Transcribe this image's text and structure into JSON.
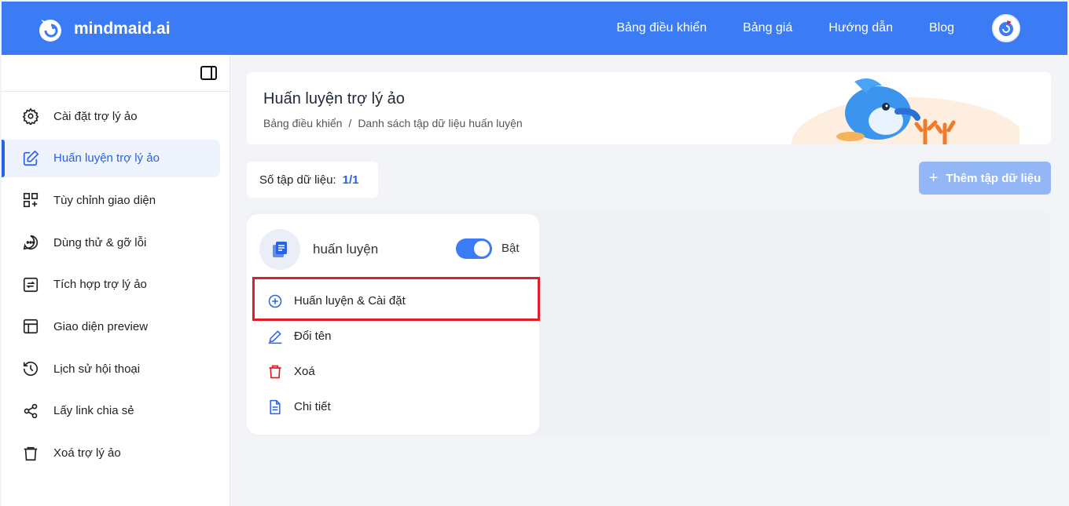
{
  "brand": {
    "name": "mindmaid.ai"
  },
  "nav": [
    "Bảng điều khiển",
    "Bảng giá",
    "Hướng dẫn",
    "Blog"
  ],
  "sidebar": {
    "items": [
      {
        "label": "Cài đặt trợ lý ảo",
        "icon": "gear-icon"
      },
      {
        "label": "Huấn luyện trợ lý ảo",
        "icon": "edit-icon",
        "active": true
      },
      {
        "label": "Tùy chỉnh giao diện",
        "icon": "grid-plus-icon"
      },
      {
        "label": "Dùng thử & gỡ lỗi",
        "icon": "chat-icon"
      },
      {
        "label": "Tích hợp trợ lý ảo",
        "icon": "integration-icon"
      },
      {
        "label": "Giao diện preview",
        "icon": "layout-icon"
      },
      {
        "label": "Lịch sử hội thoại",
        "icon": "history-icon"
      },
      {
        "label": "Lấy link chia sẻ",
        "icon": "share-icon"
      },
      {
        "label": "Xoá trợ lý ảo",
        "icon": "trash-icon"
      }
    ]
  },
  "header": {
    "title": "Huấn luyện trợ lý ảo",
    "breadcrumb": [
      "Bảng điều khiển",
      "/",
      "Danh sách tập dữ liệu huấn luyện"
    ]
  },
  "count": {
    "label": "Số tập dữ liệu:",
    "value": "1/1"
  },
  "add_button": {
    "label": "Thêm tập dữ liệu"
  },
  "dataset": {
    "name": "huấn luyện",
    "toggle_label": "Bật",
    "actions": [
      {
        "label": "Huấn luyện & Cài đặt",
        "icon": "plus-circle-icon"
      },
      {
        "label": "Đổi tên",
        "icon": "pencil-icon"
      },
      {
        "label": "Xoá",
        "icon": "trash-icon"
      },
      {
        "label": "Chi tiết",
        "icon": "document-icon"
      }
    ]
  },
  "colors": {
    "primary": "#3b7cf5",
    "highlight": "#e11d2a",
    "danger": "#e11d2a"
  }
}
